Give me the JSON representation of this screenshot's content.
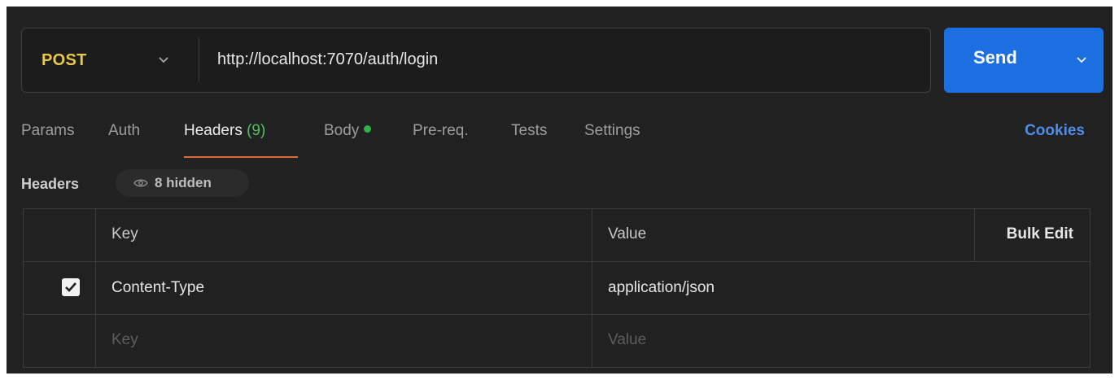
{
  "request": {
    "method": "POST",
    "url": "http://localhost:7070/auth/login",
    "send_label": "Send"
  },
  "tabs": [
    {
      "label": "Params"
    },
    {
      "label": "Auth"
    },
    {
      "label": "Headers",
      "count": "(9)",
      "active": true
    },
    {
      "label": "Body",
      "indicator": "green-dot"
    },
    {
      "label": "Pre-req."
    },
    {
      "label": "Tests"
    },
    {
      "label": "Settings"
    }
  ],
  "cookies_label": "Cookies",
  "headers_section": {
    "title": "Headers",
    "hidden_label": "8 hidden"
  },
  "table": {
    "columns": {
      "key": "Key",
      "value": "Value",
      "bulk_edit": "Bulk Edit"
    },
    "rows": [
      {
        "checked": true,
        "key": "Content-Type",
        "value": "application/json"
      }
    ],
    "new_row": {
      "key_placeholder": "Key",
      "value_placeholder": "Value"
    }
  },
  "colors": {
    "method": "#e7c84b",
    "send": "#1c6fe0",
    "active_tab_underline": "#e06a3c",
    "count": "#4cc363",
    "link": "#4f8de8",
    "background": "#212121"
  }
}
